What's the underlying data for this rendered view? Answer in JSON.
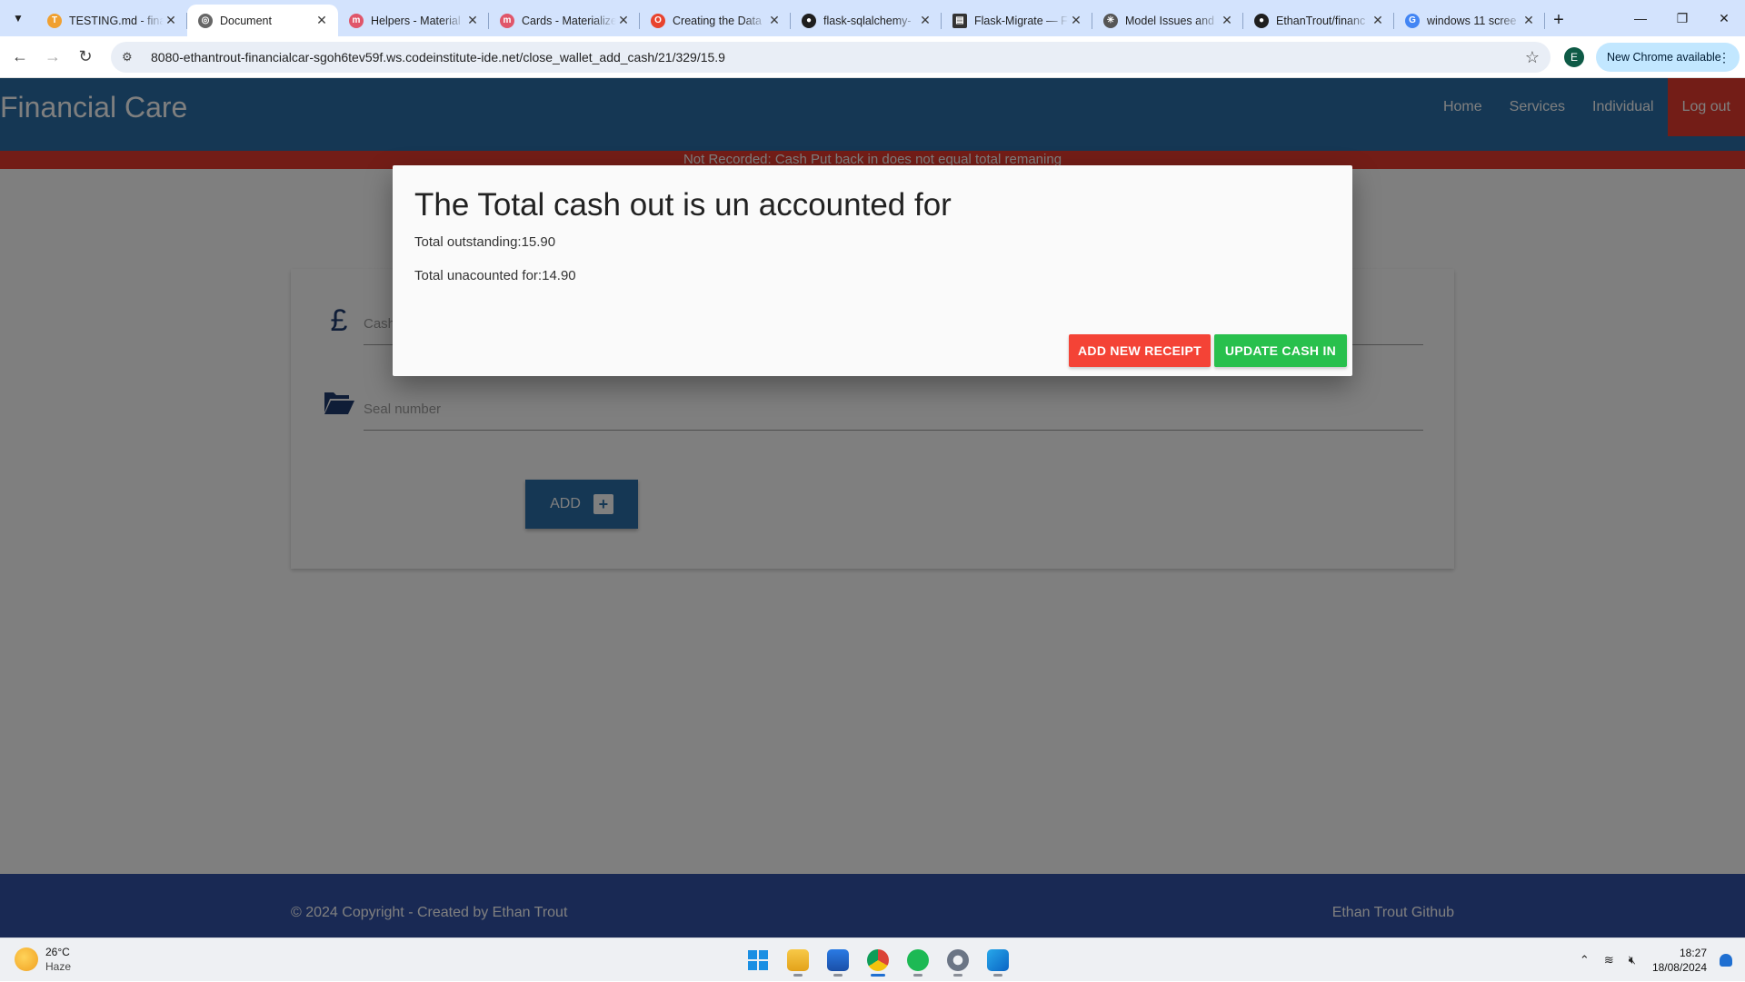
{
  "browser": {
    "tabs": [
      {
        "title": "TESTING.md - fina",
        "icon": "testing-icon",
        "color": "#f0a030"
      },
      {
        "title": "Document",
        "icon": "globe-icon",
        "color": "#666666",
        "active": true
      },
      {
        "title": "Helpers - Material",
        "icon": "materialize-icon",
        "color": "#e0566a"
      },
      {
        "title": "Cards - Materialize",
        "icon": "materialize-icon",
        "color": "#e0566a"
      },
      {
        "title": "Creating the Data",
        "icon": "opera-icon",
        "color": "#e8432e"
      },
      {
        "title": "flask-sqlalchemy-",
        "icon": "github-icon",
        "color": "#1f1f1f"
      },
      {
        "title": "Flask-Migrate — F",
        "icon": "docs-icon",
        "color": "#333333"
      },
      {
        "title": "Model Issues and",
        "icon": "openai-icon",
        "color": "#555555"
      },
      {
        "title": "EthanTrout/financ",
        "icon": "github-icon",
        "color": "#1f1f1f"
      },
      {
        "title": "windows 11 scree",
        "icon": "google-icon",
        "color": "#4285f4"
      }
    ],
    "url": "8080-ethantrout-financialcar-sgoh6tev59f.ws.codeinstitute-ide.net/close_wallet_add_cash/21/329/15.9",
    "profile_initial": "E",
    "new_chrome_label": "New Chrome available"
  },
  "site": {
    "brand": "Financial Care",
    "nav": [
      "Home",
      "Services",
      "Individual",
      "Log out"
    ],
    "flash": "Not Recorded: Cash Put back in does not equal total remaning",
    "form": {
      "cash_placeholder": "Cash",
      "seal_placeholder": "Seal number",
      "add_label": "ADD"
    },
    "footer": {
      "copyright": "© 2024 Copyright - Created by Ethan Trout",
      "github_link": "Ethan Trout Github"
    }
  },
  "modal": {
    "title": "The Total cash out is un accounted for",
    "outstanding": "Total outstanding:15.90",
    "unaccounted": "Total unacounted for:14.90",
    "add_receipt_label": "ADD NEW RECEIPT",
    "update_cash_label": "UPDATE CASH IN"
  },
  "taskbar": {
    "temperature": "26°C",
    "condition": "Haze",
    "time": "18:27",
    "date": "18/08/2024"
  },
  "colors": {
    "nav_blue": "#2a6fa8",
    "logout_red": "#e63a2e",
    "footer_blue": "#3352a8",
    "receipt_red": "#f44336",
    "update_green": "#28c04d"
  }
}
